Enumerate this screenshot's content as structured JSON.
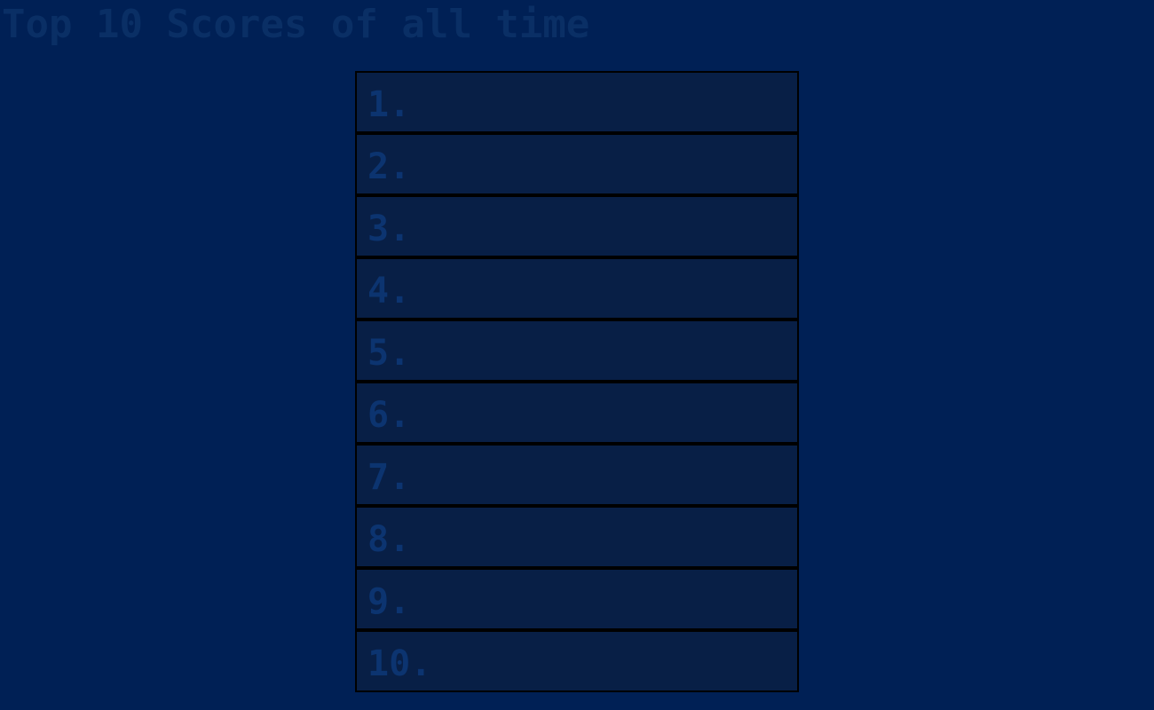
{
  "title": "Top 10 Scores of all time",
  "colors": {
    "background": "#002055",
    "row_background": "#081f46",
    "row_border": "#000000",
    "text": "#0c3470"
  },
  "scores": [
    {
      "rank": "1."
    },
    {
      "rank": "2."
    },
    {
      "rank": "3."
    },
    {
      "rank": "4."
    },
    {
      "rank": "5."
    },
    {
      "rank": "6."
    },
    {
      "rank": "7."
    },
    {
      "rank": "8."
    },
    {
      "rank": "9."
    },
    {
      "rank": "10."
    }
  ]
}
